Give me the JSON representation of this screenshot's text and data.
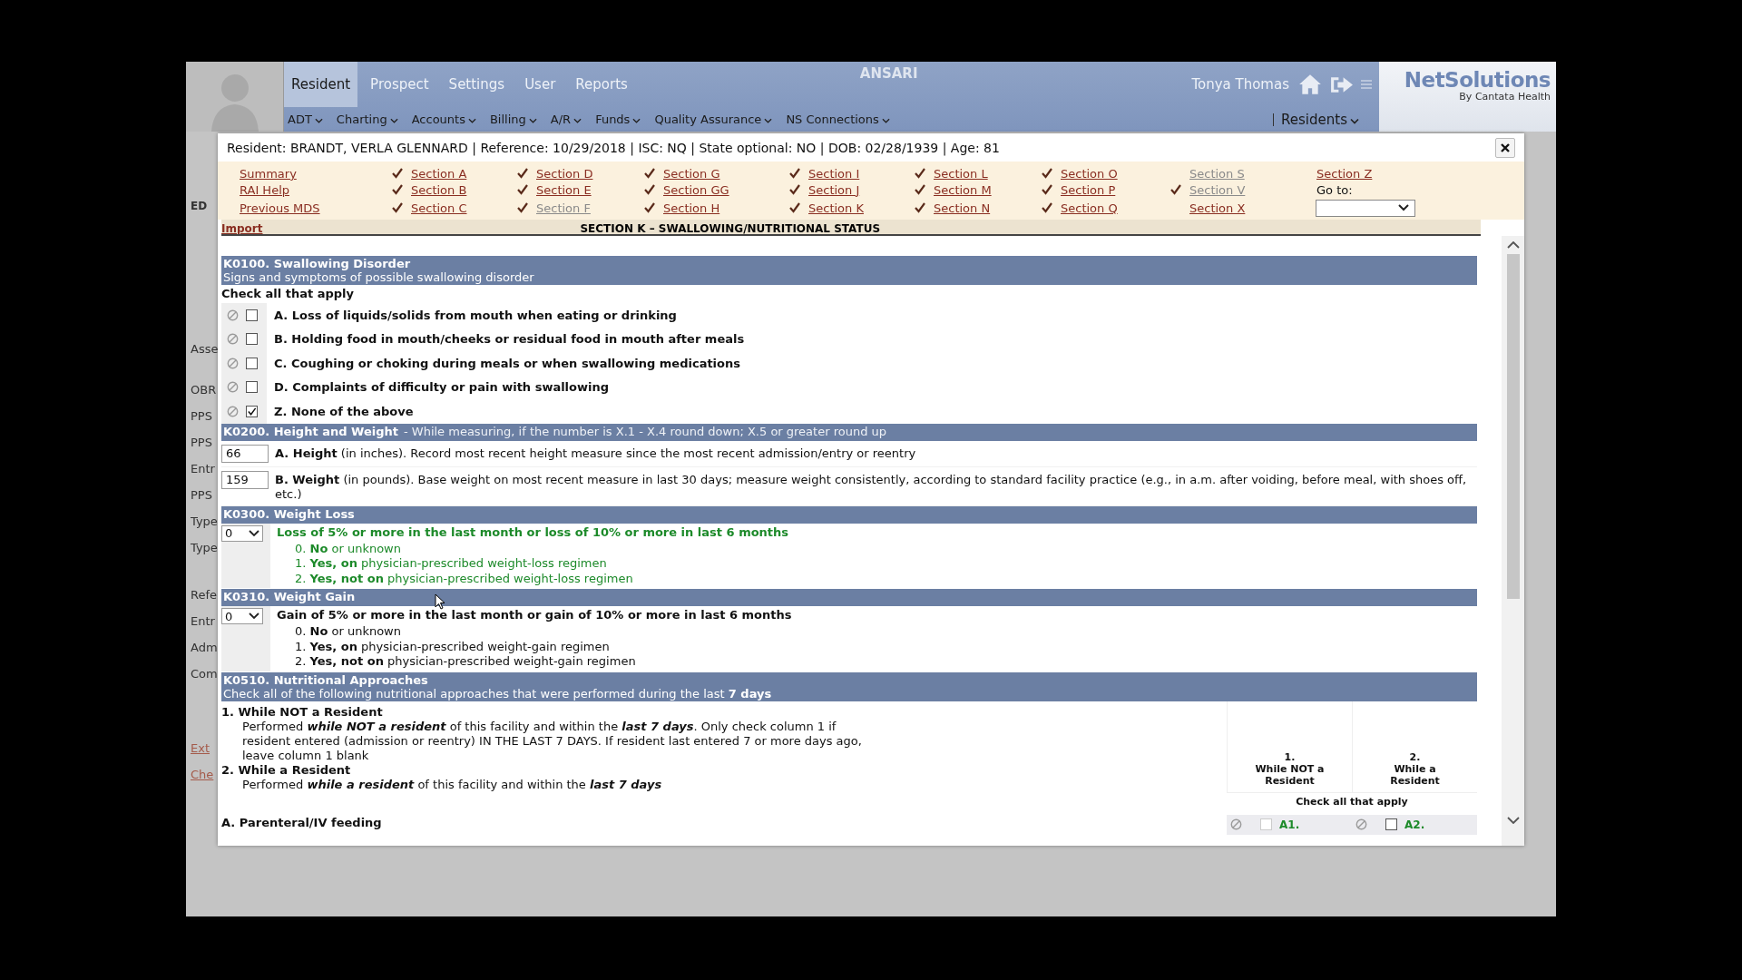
{
  "app": {
    "tabs": [
      {
        "label": "Resident",
        "selected": true
      },
      {
        "label": "Prospect",
        "selected": false
      },
      {
        "label": "Settings",
        "selected": false
      },
      {
        "label": "User",
        "selected": false
      },
      {
        "label": "Reports",
        "selected": false
      }
    ],
    "title": "ANSARI",
    "user": "Tonya Thomas",
    "logo": {
      "name": "NetSolutions",
      "tagline": "By Cantata Health"
    },
    "menu": [
      "ADT",
      "Charting",
      "Accounts",
      "Billing",
      "A/R",
      "Funds",
      "Quality Assurance",
      "NS Connections"
    ],
    "residents_menu": "Residents",
    "side_labels": [
      {
        "text": "ED",
        "kind": "text"
      },
      {
        "text": "Asse",
        "kind": "text"
      },
      {
        "text": "OBR",
        "kind": "text"
      },
      {
        "text": "PPS",
        "kind": "text"
      },
      {
        "text": "PPS",
        "kind": "text"
      },
      {
        "text": "Entr",
        "kind": "text"
      },
      {
        "text": "PPS",
        "kind": "text"
      },
      {
        "text": "Type",
        "kind": "text"
      },
      {
        "text": "Type",
        "kind": "text"
      },
      {
        "text": "Refe",
        "kind": "text"
      },
      {
        "text": "Entr",
        "kind": "text"
      },
      {
        "text": "Adm",
        "kind": "text"
      },
      {
        "text": "Com",
        "kind": "text"
      },
      {
        "text": "Ext",
        "kind": "link"
      },
      {
        "text": "Che",
        "kind": "link"
      }
    ]
  },
  "dialog": {
    "header": "Resident: BRANDT, VERLA GLENNARD | Reference: 10/29/2018 | ISC: NQ | State optional: NO | DOB: 02/28/1939 | Age: 81",
    "nav": [
      {
        "kind": "link",
        "label": "Summary",
        "checked": false,
        "disabled": false
      },
      {
        "kind": "link",
        "label": "RAI Help",
        "checked": false,
        "disabled": false
      },
      {
        "kind": "link",
        "label": "Previous MDS",
        "checked": false,
        "disabled": false
      },
      {
        "kind": "link",
        "label": "Section A",
        "checked": true,
        "disabled": false
      },
      {
        "kind": "link",
        "label": "Section B",
        "checked": true,
        "disabled": false
      },
      {
        "kind": "link",
        "label": "Section C",
        "checked": true,
        "disabled": false
      },
      {
        "kind": "link",
        "label": "Section D",
        "checked": true,
        "disabled": false
      },
      {
        "kind": "link",
        "label": "Section E",
        "checked": true,
        "disabled": false
      },
      {
        "kind": "link",
        "label": "Section F",
        "checked": true,
        "disabled": true
      },
      {
        "kind": "link",
        "label": "Section G",
        "checked": true,
        "disabled": false
      },
      {
        "kind": "link",
        "label": "Section GG",
        "checked": true,
        "disabled": false
      },
      {
        "kind": "link",
        "label": "Section H",
        "checked": true,
        "disabled": false
      },
      {
        "kind": "link",
        "label": "Section I",
        "checked": true,
        "disabled": false
      },
      {
        "kind": "link",
        "label": "Section J",
        "checked": true,
        "disabled": false
      },
      {
        "kind": "link",
        "label": "Section K",
        "checked": true,
        "disabled": false
      },
      {
        "kind": "link",
        "label": "Section L",
        "checked": true,
        "disabled": false
      },
      {
        "kind": "link",
        "label": "Section M",
        "checked": true,
        "disabled": false
      },
      {
        "kind": "link",
        "label": "Section N",
        "checked": true,
        "disabled": false
      },
      {
        "kind": "link",
        "label": "Section O",
        "checked": true,
        "disabled": false
      },
      {
        "kind": "link",
        "label": "Section P",
        "checked": true,
        "disabled": false
      },
      {
        "kind": "link",
        "label": "Section Q",
        "checked": true,
        "disabled": false
      },
      {
        "kind": "link",
        "label": "Section S",
        "checked": false,
        "disabled": true
      },
      {
        "kind": "link",
        "label": "Section V",
        "checked": true,
        "disabled": true
      },
      {
        "kind": "link",
        "label": "Section X",
        "checked": false,
        "disabled": false
      },
      {
        "kind": "link",
        "label": "Section Z",
        "checked": false,
        "disabled": false
      },
      {
        "kind": "label",
        "label": "Go to:"
      },
      {
        "kind": "select"
      }
    ],
    "import_link": "Import",
    "section_title": "SECTION K – SWALLOWING/NUTRITIONAL STATUS",
    "sections": [
      {
        "kind": "checklist",
        "code": "K0100. Swallowing Disorder",
        "subtitle": "Signs and symptoms of possible swallowing disorder",
        "instruction": "Check all that apply",
        "items": [
          {
            "text": "A. Loss of liquids/solids from mouth when eating or drinking",
            "checked": false
          },
          {
            "text": "B. Holding food in mouth/cheeks or residual food in mouth after meals",
            "checked": false
          },
          {
            "text": "C. Coughing or choking during meals or when swallowing medications",
            "checked": false
          },
          {
            "text": "D. Complaints of difficulty or pain with swallowing",
            "checked": false
          },
          {
            "text": "Z. None of the above",
            "checked": true
          }
        ]
      },
      {
        "kind": "measures",
        "code": "K0200. Height and Weight",
        "note": "- While measuring, if the number is X.1 - X.4 round down; X.5 or greater round up",
        "rows": [
          {
            "value": "66",
            "text": "**A. Height** (in inches). Record most recent height measure since the most recent admission/entry or reentry"
          },
          {
            "value": "159",
            "text": "**B. Weight** (in pounds). Base weight on most recent measure in last 30 days; measure weight consistently, according to standard facility practice (e.g., in a.m. after voiding, before meal, with shoes off, etc.)"
          }
        ]
      },
      {
        "kind": "coded",
        "code": "K0300. Weight Loss",
        "value": "0",
        "highlighted": true,
        "question": "Loss of 5% or more in the last month or loss of 10% or more in last 6 months",
        "options": [
          "0. **No** or unknown",
          "1. **Yes, on** physician-prescribed weight-loss regimen",
          "2. **Yes, not on** physician-prescribed weight-loss regimen"
        ]
      },
      {
        "kind": "coded",
        "code": "K0310. Weight Gain",
        "value": "0",
        "highlighted": false,
        "question": "Gain of 5% or more in the last month or gain of 10% or more in last 6 months",
        "options": [
          "0. **No** or unknown",
          "1. **Yes, on** physician-prescribed weight-gain regimen",
          "2. **Yes, not on** physician-prescribed weight-gain regimen"
        ]
      },
      {
        "kind": "approaches",
        "code": "K0510. Nutritional Approaches",
        "subtitle": "Check all of the following nutritional approaches that were performed during the last **7 days**",
        "notes": [
          {
            "title": "1. While NOT a Resident",
            "text": "Performed **while NOT a resident** of this facility and within the **last 7 days**. Only check column 1 if resident entered (admission or reentry) IN THE LAST 7 DAYS. If resident last entered 7 or more days ago, leave column 1 blank"
          },
          {
            "title": "2. While a Resident",
            "text": "Performed **while a resident** of this facility and within the **last 7 days**"
          }
        ],
        "columns": [
          {
            "number": "1.",
            "label": "While NOT a Resident"
          },
          {
            "number": "2.",
            "label": "While a Resident"
          }
        ],
        "columns_note": "Check all that apply",
        "rows": [
          {
            "label": "A. Parenteral/IV feeding",
            "cells": [
              {
                "code": "A1.",
                "checked": false,
                "disabled": true
              },
              {
                "code": "A2.",
                "checked": false,
                "disabled": false
              }
            ]
          }
        ]
      }
    ]
  }
}
